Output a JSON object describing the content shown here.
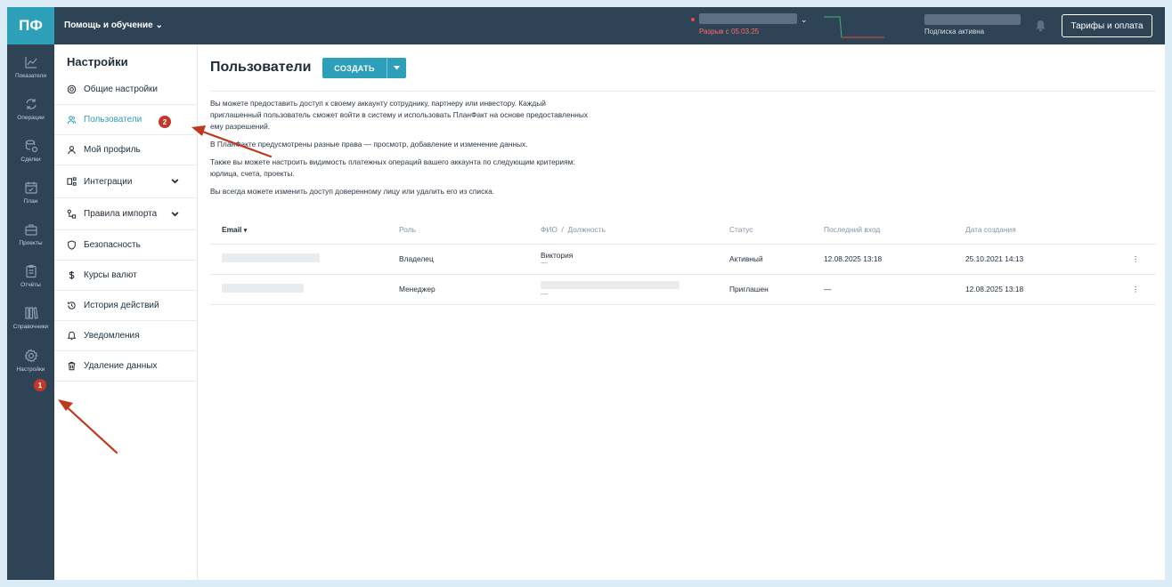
{
  "app": {
    "logo": "ПФ",
    "help_menu": "Помощь и обучение"
  },
  "topbar": {
    "gap_text": "Разрыв с 05.03.25",
    "subscription": "Подписка активна",
    "tariff_button": "Тарифы и оплата"
  },
  "rail": {
    "items": [
      {
        "label": "Показатели",
        "icon": "chart-icon"
      },
      {
        "label": "Операции",
        "icon": "operations-icon"
      },
      {
        "label": "Сделки",
        "icon": "deals-icon"
      },
      {
        "label": "План",
        "icon": "calendar-icon"
      },
      {
        "label": "Проекты",
        "icon": "briefcase-icon"
      },
      {
        "label": "Отчёты",
        "icon": "clipboard-icon"
      },
      {
        "label": "Справочники",
        "icon": "books-icon"
      },
      {
        "label": "Настройки",
        "icon": "gear-icon"
      }
    ],
    "badge": "1"
  },
  "settings": {
    "title": "Настройки",
    "items": [
      {
        "label": "Общие настройки",
        "icon": "gear-icon"
      },
      {
        "label": "Пользователи",
        "icon": "users-icon",
        "active": true
      },
      {
        "label": "Мой профиль",
        "icon": "user-icon"
      },
      {
        "label": "Интеграции",
        "icon": "integrations-icon",
        "expandable": true
      },
      {
        "label": "Правила импорта",
        "icon": "rules-icon",
        "expandable": true
      },
      {
        "label": "Безопасность",
        "icon": "shield-icon"
      },
      {
        "label": "Курсы валют",
        "icon": "dollar-icon"
      },
      {
        "label": "История действий",
        "icon": "history-icon"
      },
      {
        "label": "Уведомления",
        "icon": "bell-icon"
      },
      {
        "label": "Удаление данных",
        "icon": "trash-icon"
      }
    ],
    "badge": "2"
  },
  "main": {
    "title": "Пользователи",
    "create_button": "СОЗДАТЬ",
    "description": [
      "Вы можете предоставить доступ к своему аккаунту сотруднику, партнеру или инвестору. Каждый приглашенный пользователь сможет войти в систему и использовать ПланФакт на основе предоставленных ему разрешений.",
      "В ПланФакте предусмотрены разные права — просмотр, добавление и изменение данных.",
      "Также вы можете настроить видимость платежных операций вашего аккаунта по следующим критериям: юрлица, счета, проекты.",
      "Вы всегда можете изменить доступ доверенному лицу или удалить его из списка."
    ],
    "table": {
      "headers": {
        "email": "Email",
        "role": "Роль",
        "fio": "ФИО  /  Должность",
        "status": "Статус",
        "last_login": "Последний вход",
        "created": "Дата создания"
      },
      "rows": [
        {
          "role": "Владелец",
          "fio_name": "Виктория",
          "fio_position": "—",
          "status": "Активный",
          "last_login": "12.08.2025 13:18",
          "created": "25.10.2021 14:13"
        },
        {
          "role": "Менеджер",
          "fio_name": "",
          "fio_position": "—",
          "status": "Приглашен",
          "last_login": "—",
          "created": "12.08.2025 13:18"
        }
      ]
    }
  },
  "colors": {
    "sidebar": "#2f4356",
    "accent": "#2d9fb9",
    "badge": "#c0392b",
    "arrow": "#c0391f"
  }
}
